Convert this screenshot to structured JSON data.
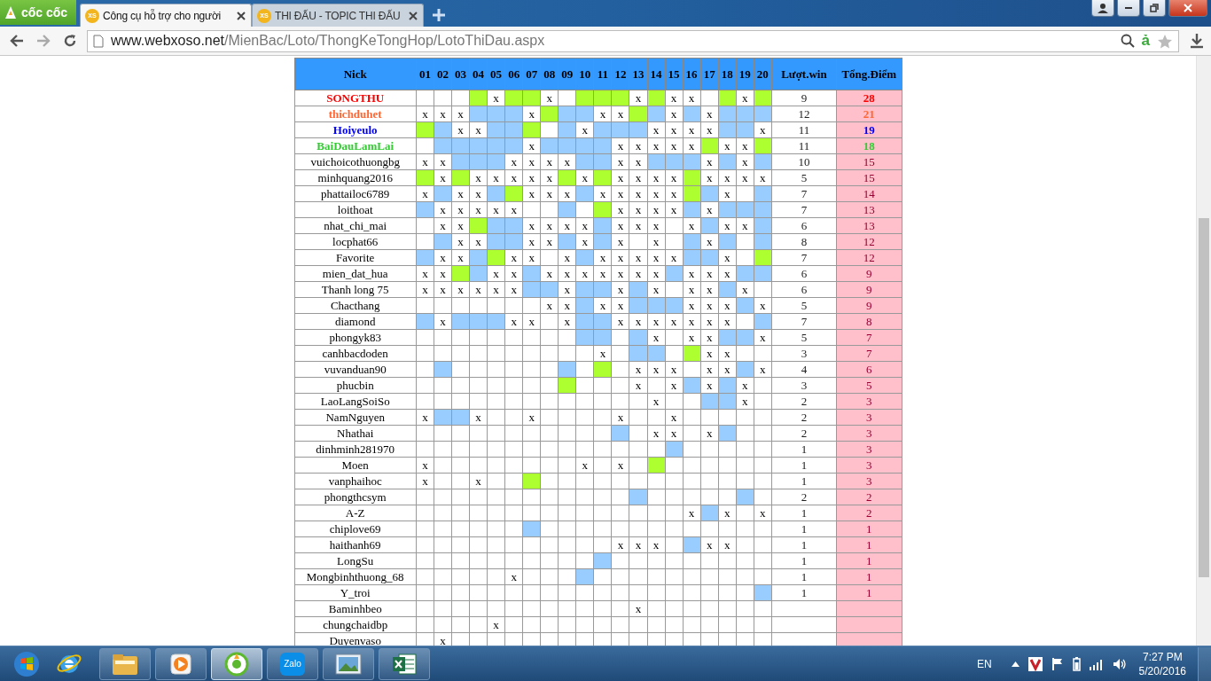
{
  "browser": {
    "brand": "cốc cốc",
    "tabs": [
      {
        "favicon": "XS",
        "title": "Công cụ hỗ trợ cho người",
        "selected": true
      },
      {
        "favicon": "XS",
        "title": "THI ĐẤU - TOPIC THI ĐẤU",
        "selected": false
      }
    ],
    "url_host": "www.webxoso.net",
    "url_path": "/MienBac/Loto/ThongKeTongHop/LotoThiDau.aspx",
    "dictionary": "ả"
  },
  "table": {
    "columns": [
      "Nick",
      "01",
      "02",
      "03",
      "04",
      "05",
      "06",
      "07",
      "08",
      "09",
      "10",
      "11",
      "12",
      "13",
      "14",
      "15",
      "16",
      "17",
      "18",
      "19",
      "20",
      "Lượt.win",
      "Tổng.Điểm"
    ],
    "rows": [
      {
        "cells": [
          {
            "text": "SONGTHU",
            "color": "#ff0000"
          },
          {},
          {},
          {},
          {
            "color": "#adff2f"
          },
          {
            "text": "x"
          },
          {
            "color": "#adff2f"
          },
          {
            "color": "#adff2f"
          },
          {
            "text": "x"
          },
          {},
          {
            "color": "#adff2f"
          },
          {
            "color": "#adff2f"
          },
          {
            "color": "#adff2f"
          },
          {
            "text": "x"
          },
          {
            "color": "#adff2f"
          },
          {
            "text": "x"
          },
          {
            "text": "x"
          },
          {},
          {
            "color": "#adff2f"
          },
          {
            "text": "x"
          },
          {
            "color": "#adff2f"
          },
          {
            "text": "9"
          },
          {
            "text": "28"
          }
        ]
      },
      {
        "cells": [
          {
            "text": "thichduhet",
            "color": "#ff6633"
          },
          {
            "text": "x"
          },
          {
            "text": "x"
          },
          {
            "text": "x"
          },
          {
            "color": "#99ccff"
          },
          {
            "color": "#99ccff"
          },
          {
            "color": "#99ccff"
          },
          {
            "text": "x"
          },
          {
            "color": "#adff2f"
          },
          {
            "color": "#99ccff"
          },
          {
            "color": "#99ccff"
          },
          {
            "text": "x"
          },
          {
            "text": "x"
          },
          {
            "color": "#adff2f"
          },
          {
            "color": "#99ccff"
          },
          {
            "text": "x"
          },
          {
            "color": "#99ccff"
          },
          {
            "text": "x"
          },
          {
            "color": "#99ccff"
          },
          {
            "color": "#99ccff"
          },
          {
            "color": "#99ccff"
          },
          {
            "text": "12"
          },
          {
            "text": "21"
          }
        ]
      },
      {
        "cells": [
          {
            "text": "Hoiyeulo",
            "color": "#0000ff"
          },
          {
            "color": "#adff2f"
          },
          {
            "color": "#99ccff"
          },
          {
            "text": "x"
          },
          {
            "text": "x"
          },
          {
            "color": "#99ccff"
          },
          {
            "color": "#99ccff"
          },
          {
            "color": "#adff2f"
          },
          {},
          {
            "color": "#99ccff"
          },
          {
            "text": "x"
          },
          {
            "color": "#99ccff"
          },
          {
            "color": "#99ccff"
          },
          {
            "color": "#99ccff"
          },
          {
            "text": "x"
          },
          {
            "text": "x"
          },
          {
            "text": "x"
          },
          {
            "text": "x"
          },
          {
            "color": "#99ccff"
          },
          {
            "color": "#99ccff"
          },
          {
            "text": "x"
          },
          {
            "text": "11"
          },
          {
            "text": "19"
          }
        ]
      },
      {
        "cells": [
          {
            "text": "BaiDauLamLai",
            "color": "#33cc33"
          },
          {},
          {
            "color": "#99ccff"
          },
          {
            "color": "#99ccff"
          },
          {
            "color": "#99ccff"
          },
          {
            "color": "#99ccff"
          },
          {
            "color": "#99ccff"
          },
          {
            "text": "x"
          },
          {
            "color": "#99ccff"
          },
          {
            "color": "#99ccff"
          },
          {
            "color": "#99ccff"
          },
          {
            "color": "#99ccff"
          },
          {
            "text": "x"
          },
          {
            "text": "x"
          },
          {
            "text": "x"
          },
          {
            "text": "x"
          },
          {
            "text": "x"
          },
          {
            "color": "#adff2f"
          },
          {
            "text": "x"
          },
          {
            "text": "x"
          },
          {
            "color": "#adff2f"
          },
          {
            "text": "11"
          },
          {
            "text": "18"
          }
        ]
      },
      {
        "cells": [
          {
            "text": "vuichoicothuongbg"
          },
          {
            "text": "x"
          },
          {
            "text": "x"
          },
          {
            "color": "#99ccff"
          },
          {
            "color": "#99ccff"
          },
          {
            "color": "#99ccff"
          },
          {
            "text": "x"
          },
          {
            "text": "x"
          },
          {
            "text": "x"
          },
          {
            "text": "x"
          },
          {
            "color": "#99ccff"
          },
          {
            "color": "#99ccff"
          },
          {
            "text": "x"
          },
          {
            "text": "x"
          },
          {
            "color": "#99ccff"
          },
          {
            "color": "#99ccff"
          },
          {
            "color": "#99ccff"
          },
          {
            "text": "x"
          },
          {
            "color": "#99ccff"
          },
          {
            "text": "x"
          },
          {
            "color": "#99ccff"
          },
          {
            "text": "10"
          },
          {
            "text": "15"
          }
        ]
      },
      {
        "cells": [
          {
            "text": "minhquang2016"
          },
          {
            "color": "#adff2f"
          },
          {
            "text": "x"
          },
          {
            "color": "#adff2f"
          },
          {
            "text": "x"
          },
          {
            "text": "x"
          },
          {
            "text": "x"
          },
          {
            "text": "x"
          },
          {
            "text": "x"
          },
          {
            "color": "#adff2f"
          },
          {
            "text": "x"
          },
          {
            "color": "#adff2f"
          },
          {
            "text": "x"
          },
          {
            "text": "x"
          },
          {
            "text": "x"
          },
          {
            "text": "x"
          },
          {
            "color": "#adff2f"
          },
          {
            "text": "x"
          },
          {
            "text": "x"
          },
          {
            "text": "x"
          },
          {
            "text": "x"
          },
          {
            "text": "5"
          },
          {
            "text": "15"
          }
        ]
      },
      {
        "cells": [
          {
            "text": "phattailoc6789"
          },
          {
            "text": "x"
          },
          {
            "color": "#99ccff"
          },
          {
            "text": "x"
          },
          {
            "text": "x"
          },
          {
            "color": "#99ccff"
          },
          {
            "color": "#adff2f"
          },
          {
            "text": "x"
          },
          {
            "text": "x"
          },
          {
            "text": "x"
          },
          {
            "color": "#99ccff"
          },
          {
            "text": "x"
          },
          {
            "text": "x"
          },
          {
            "text": "x"
          },
          {
            "text": "x"
          },
          {
            "text": "x"
          },
          {
            "color": "#adff2f"
          },
          {
            "color": "#99ccff"
          },
          {
            "text": "x"
          },
          {},
          {
            "color": "#99ccff"
          },
          {
            "text": "7"
          },
          {
            "text": "14"
          }
        ]
      },
      {
        "cells": [
          {
            "text": "loithoat"
          },
          {
            "color": "#99ccff"
          },
          {
            "text": "x"
          },
          {
            "text": "x"
          },
          {
            "text": "x"
          },
          {
            "text": "x"
          },
          {
            "text": "x"
          },
          {},
          {},
          {
            "color": "#99ccff"
          },
          {},
          {
            "color": "#adff2f"
          },
          {
            "text": "x"
          },
          {
            "text": "x"
          },
          {
            "text": "x"
          },
          {
            "text": "x"
          },
          {
            "color": "#99ccff"
          },
          {
            "text": "x"
          },
          {
            "color": "#99ccff"
          },
          {
            "color": "#99ccff"
          },
          {
            "color": "#99ccff"
          },
          {
            "text": "7"
          },
          {
            "text": "13"
          }
        ]
      },
      {
        "cells": [
          {
            "text": "nhat_chi_mai"
          },
          {},
          {
            "text": "x"
          },
          {
            "text": "x"
          },
          {
            "color": "#adff2f"
          },
          {
            "color": "#99ccff"
          },
          {
            "color": "#99ccff"
          },
          {
            "text": "x"
          },
          {
            "text": "x"
          },
          {
            "text": "x"
          },
          {
            "text": "x"
          },
          {
            "color": "#99ccff"
          },
          {
            "text": "x"
          },
          {
            "text": "x"
          },
          {
            "text": "x"
          },
          {},
          {
            "text": "x"
          },
          {
            "color": "#99ccff"
          },
          {
            "text": "x"
          },
          {
            "text": "x"
          },
          {
            "color": "#99ccff"
          },
          {
            "text": "6"
          },
          {
            "text": "13"
          }
        ]
      },
      {
        "cells": [
          {
            "text": "locphat66"
          },
          {},
          {
            "color": "#99ccff"
          },
          {
            "text": "x"
          },
          {
            "text": "x"
          },
          {
            "color": "#99ccff"
          },
          {
            "color": "#99ccff"
          },
          {
            "text": "x"
          },
          {
            "text": "x"
          },
          {
            "color": "#99ccff"
          },
          {
            "text": "x"
          },
          {
            "color": "#99ccff"
          },
          {
            "text": "x"
          },
          {},
          {
            "text": "x"
          },
          {},
          {
            "color": "#99ccff"
          },
          {
            "text": "x"
          },
          {
            "color": "#99ccff"
          },
          {},
          {
            "color": "#99ccff"
          },
          {
            "text": "8"
          },
          {
            "text": "12"
          }
        ]
      },
      {
        "cells": [
          {
            "text": "Favorite"
          },
          {
            "color": "#99ccff"
          },
          {
            "text": "x"
          },
          {
            "text": "x"
          },
          {
            "color": "#99ccff"
          },
          {
            "color": "#adff2f"
          },
          {
            "text": "x"
          },
          {
            "text": "x"
          },
          {},
          {
            "text": "x"
          },
          {
            "color": "#99ccff"
          },
          {
            "text": "x"
          },
          {
            "text": "x"
          },
          {
            "text": "x"
          },
          {
            "text": "x"
          },
          {
            "text": "x"
          },
          {
            "color": "#99ccff"
          },
          {
            "color": "#99ccff"
          },
          {
            "text": "x"
          },
          {},
          {
            "color": "#adff2f"
          },
          {
            "text": "7"
          },
          {
            "text": "12"
          }
        ]
      },
      {
        "cells": [
          {
            "text": "mien_dat_hua"
          },
          {
            "text": "x"
          },
          {
            "text": "x"
          },
          {
            "color": "#adff2f"
          },
          {
            "color": "#99ccff"
          },
          {
            "text": "x"
          },
          {
            "text": "x"
          },
          {
            "color": "#99ccff"
          },
          {
            "text": "x"
          },
          {
            "text": "x"
          },
          {
            "text": "x"
          },
          {
            "text": "x"
          },
          {
            "text": "x"
          },
          {
            "text": "x"
          },
          {
            "text": "x"
          },
          {
            "color": "#99ccff"
          },
          {
            "text": "x"
          },
          {
            "text": "x"
          },
          {
            "text": "x"
          },
          {
            "color": "#99ccff"
          },
          {
            "color": "#99ccff"
          },
          {
            "text": "6"
          },
          {
            "text": "9"
          }
        ]
      },
      {
        "cells": [
          {
            "text": "Thanh long 75"
          },
          {
            "text": "x"
          },
          {
            "text": "x"
          },
          {
            "text": "x"
          },
          {
            "text": "x"
          },
          {
            "text": "x"
          },
          {
            "text": "x"
          },
          {
            "color": "#99ccff"
          },
          {
            "color": "#99ccff"
          },
          {
            "text": "x"
          },
          {
            "color": "#99ccff"
          },
          {
            "color": "#99ccff"
          },
          {
            "text": "x"
          },
          {
            "color": "#99ccff"
          },
          {
            "text": "x"
          },
          {},
          {
            "text": "x"
          },
          {
            "text": "x"
          },
          {
            "color": "#99ccff"
          },
          {
            "text": "x"
          },
          {},
          {
            "text": "6"
          },
          {
            "text": "9"
          }
        ]
      },
      {
        "cells": [
          {
            "text": "Chacthang"
          },
          {},
          {},
          {},
          {},
          {},
          {},
          {},
          {
            "text": "x"
          },
          {
            "text": "x"
          },
          {
            "color": "#99ccff"
          },
          {
            "text": "x"
          },
          {
            "text": "x"
          },
          {
            "color": "#99ccff"
          },
          {
            "color": "#99ccff"
          },
          {
            "color": "#99ccff"
          },
          {
            "text": "x"
          },
          {
            "text": "x"
          },
          {
            "text": "x"
          },
          {
            "color": "#99ccff"
          },
          {
            "text": "x"
          },
          {
            "text": "5"
          },
          {
            "text": "9"
          }
        ]
      },
      {
        "cells": [
          {
            "text": "diamond"
          },
          {
            "color": "#99ccff"
          },
          {
            "text": "x"
          },
          {
            "color": "#99ccff"
          },
          {
            "color": "#99ccff"
          },
          {
            "color": "#99ccff"
          },
          {
            "text": "x"
          },
          {
            "text": "x"
          },
          {},
          {
            "text": "x"
          },
          {
            "color": "#99ccff"
          },
          {
            "color": "#99ccff"
          },
          {
            "text": "x"
          },
          {
            "text": "x"
          },
          {
            "text": "x"
          },
          {
            "text": "x"
          },
          {
            "text": "x"
          },
          {
            "text": "x"
          },
          {
            "text": "x"
          },
          {},
          {
            "color": "#99ccff"
          },
          {
            "text": "7"
          },
          {
            "text": "8"
          }
        ]
      },
      {
        "cells": [
          {
            "text": "phongyk83"
          },
          {},
          {},
          {},
          {},
          {},
          {},
          {},
          {},
          {},
          {
            "color": "#99ccff"
          },
          {
            "color": "#99ccff"
          },
          {},
          {
            "color": "#99ccff"
          },
          {
            "text": "x"
          },
          {},
          {
            "text": "x"
          },
          {
            "text": "x"
          },
          {
            "color": "#99ccff"
          },
          {
            "color": "#99ccff"
          },
          {
            "text": "x"
          },
          {
            "text": "5"
          },
          {
            "text": "7"
          }
        ]
      },
      {
        "cells": [
          {
            "text": "canhbacdoden"
          },
          {},
          {},
          {},
          {},
          {},
          {},
          {},
          {},
          {},
          {},
          {
            "text": "x"
          },
          {},
          {
            "color": "#99ccff"
          },
          {
            "color": "#99ccff"
          },
          {},
          {
            "color": "#adff2f"
          },
          {
            "text": "x"
          },
          {
            "text": "x"
          },
          {},
          {},
          {
            "text": "3"
          },
          {
            "text": "7"
          }
        ]
      },
      {
        "cells": [
          {
            "text": "vuvanduan90"
          },
          {},
          {
            "color": "#99ccff"
          },
          {},
          {},
          {},
          {},
          {},
          {},
          {
            "color": "#99ccff"
          },
          {},
          {
            "color": "#adff2f"
          },
          {},
          {
            "text": "x"
          },
          {
            "text": "x"
          },
          {
            "text": "x"
          },
          {},
          {
            "text": "x"
          },
          {
            "text": "x"
          },
          {
            "color": "#99ccff"
          },
          {
            "text": "x"
          },
          {
            "text": "4"
          },
          {
            "text": "6"
          }
        ]
      },
      {
        "cells": [
          {
            "text": "phucbin"
          },
          {},
          {},
          {},
          {},
          {},
          {},
          {},
          {},
          {
            "color": "#adff2f"
          },
          {},
          {},
          {},
          {
            "text": "x"
          },
          {},
          {
            "text": "x"
          },
          {
            "color": "#99ccff"
          },
          {
            "text": "x"
          },
          {
            "color": "#99ccff"
          },
          {
            "text": "x"
          },
          {},
          {
            "text": "3"
          },
          {
            "text": "5"
          }
        ]
      },
      {
        "cells": [
          {
            "text": "LaoLangSoiSo"
          },
          {},
          {},
          {},
          {},
          {},
          {},
          {},
          {},
          {},
          {},
          {},
          {},
          {},
          {
            "text": "x"
          },
          {},
          {},
          {
            "color": "#99ccff"
          },
          {
            "color": "#99ccff"
          },
          {
            "text": "x"
          },
          {},
          {
            "text": "2"
          },
          {
            "text": "3"
          }
        ]
      },
      {
        "cells": [
          {
            "text": "NamNguyen"
          },
          {
            "text": "x"
          },
          {
            "color": "#99ccff"
          },
          {
            "color": "#99ccff"
          },
          {
            "text": "x"
          },
          {},
          {},
          {
            "text": "x"
          },
          {},
          {},
          {},
          {},
          {
            "text": "x"
          },
          {},
          {},
          {
            "text": "x"
          },
          {},
          {},
          {},
          {},
          {},
          {
            "text": "2"
          },
          {
            "text": "3"
          }
        ]
      },
      {
        "cells": [
          {
            "text": "Nhathai"
          },
          {},
          {},
          {},
          {},
          {},
          {},
          {},
          {},
          {},
          {},
          {},
          {
            "color": "#99ccff"
          },
          {},
          {
            "text": "x"
          },
          {
            "text": "x"
          },
          {},
          {
            "text": "x"
          },
          {
            "color": "#99ccff"
          },
          {},
          {},
          {
            "text": "2"
          },
          {
            "text": "3"
          }
        ]
      },
      {
        "cells": [
          {
            "text": "dinhminh281970"
          },
          {},
          {},
          {},
          {},
          {},
          {},
          {},
          {},
          {},
          {},
          {},
          {},
          {},
          {},
          {
            "color": "#99ccff"
          },
          {},
          {},
          {},
          {},
          {},
          {
            "text": "1"
          },
          {
            "text": "3"
          }
        ]
      },
      {
        "cells": [
          {
            "text": "Moen"
          },
          {
            "text": "x"
          },
          {},
          {},
          {},
          {},
          {},
          {},
          {},
          {},
          {
            "text": "x"
          },
          {},
          {
            "text": "x"
          },
          {},
          {
            "color": "#adff2f"
          },
          {},
          {},
          {},
          {},
          {},
          {},
          {
            "text": "1"
          },
          {
            "text": "3"
          }
        ]
      },
      {
        "cells": [
          {
            "text": "vanphaihoc"
          },
          {
            "text": "x"
          },
          {},
          {},
          {
            "text": "x"
          },
          {},
          {},
          {
            "color": "#adff2f"
          },
          {},
          {},
          {},
          {},
          {},
          {},
          {},
          {},
          {},
          {},
          {},
          {},
          {},
          {
            "text": "1"
          },
          {
            "text": "3"
          }
        ]
      },
      {
        "cells": [
          {
            "text": "phongthcsym"
          },
          {},
          {},
          {},
          {},
          {},
          {},
          {},
          {},
          {},
          {},
          {},
          {},
          {
            "color": "#99ccff"
          },
          {},
          {},
          {},
          {},
          {},
          {
            "color": "#99ccff"
          },
          {},
          {
            "text": "2"
          },
          {
            "text": "2"
          }
        ]
      },
      {
        "cells": [
          {
            "text": "A-Z"
          },
          {},
          {},
          {},
          {},
          {},
          {},
          {},
          {},
          {},
          {},
          {},
          {},
          {},
          {},
          {},
          {
            "text": "x"
          },
          {
            "color": "#99ccff"
          },
          {
            "text": "x"
          },
          {},
          {
            "text": "x"
          },
          {
            "text": "1"
          },
          {
            "text": "2"
          }
        ]
      },
      {
        "cells": [
          {
            "text": "chiplove69"
          },
          {},
          {},
          {},
          {},
          {},
          {},
          {
            "color": "#99ccff"
          },
          {},
          {},
          {},
          {},
          {},
          {},
          {},
          {},
          {},
          {},
          {},
          {},
          {},
          {
            "text": "1"
          },
          {
            "text": "1"
          }
        ]
      },
      {
        "cells": [
          {
            "text": "haithanh69"
          },
          {},
          {},
          {},
          {},
          {},
          {},
          {},
          {},
          {},
          {},
          {},
          {
            "text": "x"
          },
          {
            "text": "x"
          },
          {
            "text": "x"
          },
          {},
          {
            "color": "#99ccff"
          },
          {
            "text": "x"
          },
          {
            "text": "x"
          },
          {},
          {},
          {
            "text": "1"
          },
          {
            "text": "1"
          }
        ]
      },
      {
        "cells": [
          {
            "text": "LongSu"
          },
          {},
          {},
          {},
          {},
          {},
          {},
          {},
          {},
          {},
          {},
          {
            "color": "#99ccff"
          },
          {},
          {},
          {},
          {},
          {},
          {},
          {},
          {},
          {},
          {
            "text": "1"
          },
          {
            "text": "1"
          }
        ]
      },
      {
        "cells": [
          {
            "text": "Mongbinhthuong_68"
          },
          {},
          {},
          {},
          {},
          {},
          {
            "text": "x"
          },
          {},
          {},
          {},
          {
            "color": "#99ccff"
          },
          {},
          {},
          {},
          {},
          {},
          {},
          {},
          {},
          {},
          {},
          {
            "text": "1"
          },
          {
            "text": "1"
          }
        ]
      },
      {
        "cells": [
          {
            "text": "Y_troi"
          },
          {},
          {},
          {},
          {},
          {},
          {},
          {},
          {},
          {},
          {},
          {},
          {},
          {},
          {},
          {},
          {},
          {},
          {},
          {},
          {
            "color": "#99ccff"
          },
          {
            "text": "1"
          },
          {
            "text": "1"
          }
        ]
      },
      {
        "cells": [
          {
            "text": "Baminhbeo"
          },
          {},
          {},
          {},
          {},
          {},
          {},
          {},
          {},
          {},
          {},
          {},
          {},
          {
            "text": "x"
          },
          {},
          {},
          {},
          {},
          {},
          {},
          {},
          {},
          {}
        ]
      },
      {
        "cells": [
          {
            "text": "chungchaidbp"
          },
          {},
          {},
          {},
          {},
          {
            "text": "x"
          },
          {},
          {},
          {},
          {},
          {},
          {},
          {},
          {},
          {},
          {},
          {},
          {},
          {},
          {},
          {},
          {},
          {}
        ]
      },
      {
        "cells": [
          {
            "text": "Duyenvaso"
          },
          {},
          {
            "text": "x"
          },
          {},
          {},
          {},
          {},
          {},
          {},
          {},
          {},
          {},
          {},
          {},
          {},
          {},
          {},
          {},
          {},
          {},
          {},
          {},
          {}
        ]
      }
    ]
  },
  "taskbar": {
    "items": [
      {
        "kind": "folder",
        "selected": false
      },
      {
        "kind": "media",
        "selected": false
      },
      {
        "kind": "coccoc",
        "selected": true
      },
      {
        "kind": "zalo",
        "label": "Zalo",
        "selected": false
      },
      {
        "kind": "photo",
        "selected": false
      },
      {
        "kind": "excel",
        "selected": false
      }
    ],
    "language": "EN",
    "time": "7:27 PM",
    "date": "5/20/2016"
  }
}
